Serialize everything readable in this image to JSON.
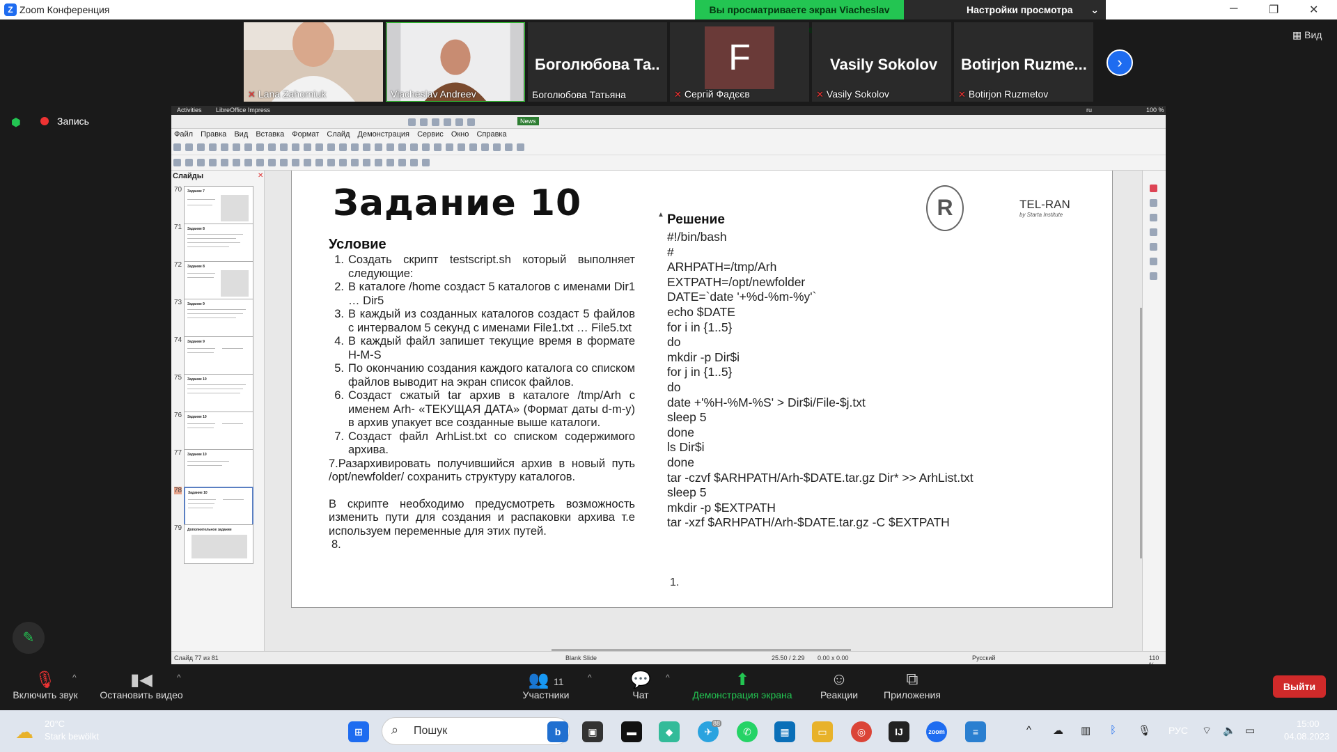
{
  "window": {
    "title": "Zoom Конференция"
  },
  "share_banner": "Вы просматриваете экран Viacheslav Andreev",
  "view_settings": "Настройки просмотра",
  "view_label": "Вид",
  "participants_strip": [
    {
      "name": "Lana Zahorniuk",
      "type": "video",
      "muted": true
    },
    {
      "name": "Viacheslav Andreev",
      "type": "video",
      "muted": false
    },
    {
      "big": "Боголюбова  Та...",
      "name": "Боголюбова Татьяна",
      "muted": false
    },
    {
      "big": "F",
      "name": "Сергій Фадєєв",
      "muted": true
    },
    {
      "big": "Vasily Sokolov",
      "name": "Vasily Sokolov",
      "muted": true
    },
    {
      "big": "Botirjon  Ruzme...",
      "name": "Botirjon Ruzmetov",
      "muted": true
    }
  ],
  "recording_label": "Запись",
  "gnome": {
    "activities": "Activities",
    "app": "LibreOffice Impress",
    "news": "News",
    "lang": "ru",
    "battery": "100 %"
  },
  "lo_menu": [
    "Файл",
    "Правка",
    "Вид",
    "Вставка",
    "Формат",
    "Слайд",
    "Демонстрация",
    "Сервис",
    "Окно",
    "Справка"
  ],
  "slides_panel": {
    "title": "Слайды",
    "thumbs": [
      {
        "num": "70",
        "title": "Задание 7"
      },
      {
        "num": "71",
        "title": "Задание 8"
      },
      {
        "num": "72",
        "title": "Задание 8"
      },
      {
        "num": "73",
        "title": "Задание 9"
      },
      {
        "num": "74",
        "title": "Задание 9"
      },
      {
        "num": "75",
        "title": "Задание 10"
      },
      {
        "num": "76",
        "title": "Задание 10"
      },
      {
        "num": "77",
        "title": "Задание 10"
      },
      {
        "num": "78",
        "title": "Задание 10"
      },
      {
        "num": "79",
        "title": "Дополнительное задание"
      }
    ]
  },
  "slide": {
    "title": "Задание 10",
    "condition_title": "Условие",
    "condition_items": [
      {
        "n": "1.",
        "text": "Создать скрипт testscript.sh который выполняет следующие:"
      },
      {
        "n": "2.",
        "text": "В каталоге /home создаст 5 каталогов с именами Dir1 … Dir5"
      },
      {
        "n": "3.",
        "text": "В каждый из созданных каталогов создаст 5 файлов с интервалом 5 секунд с именами File1.txt … File5.txt"
      },
      {
        "n": "4.",
        "text": "В каждый файл запишет текущие время в формате H-M-S"
      },
      {
        "n": "5.",
        "text": "По окончанию создания каждого каталога со списком файлов выводит на экран список файлов."
      },
      {
        "n": "6.",
        "text": "Создаст сжатый tar архив в каталоге /tmp/Arh с именем Arh- «ТЕКУЩАЯ ДАТА» (Формат даты d-m-y) в архив упакует все созданные выше каталоги."
      },
      {
        "n": "7.",
        "text": "Создаст файл ArhList.txt со списком содержимого архива."
      }
    ],
    "condition_extra": " 7.Разархивировать получившийся архив в новый путь /opt/newfolder/ сохранить структуру каталогов.",
    "condition_note": "В скрипте необходимо предусмотреть возможность изменить пути для создания и распаковки архива т.е используем переменные для этих путей.",
    "condition_last": "8.",
    "solution_title": "Решение",
    "solution_code": "#!/bin/bash\n#\nARHPATH=/tmp/Arh\nEXTPATH=/opt/newfolder\nDATE=`date '+%d-%m-%y'`\necho $DATE\nfor i in {1..5}\ndo\nmkdir -p Dir$i\nfor j in {1..5}\ndo\ndate +'%H-%M-%S' > Dir$i/File-$j.txt\nsleep 5\ndone\nls Dir$i\ndone\ntar -czvf $ARHPATH/Arh-$DATE.tar.gz Dir* >> ArhList.txt\nsleep 5\nmkdir -p $EXTPATH\ntar -xzf $ARHPATH/Arh-$DATE.tar.gz -C $EXTPATH",
    "solution_num": "1.",
    "brand": "TEL-RAN",
    "brand_sub": "by Starta Institute"
  },
  "lo_status": {
    "slide": "Слайд 77 из 81",
    "layout": "Blank Slide",
    "pos": "25.50 / 2.29",
    "size": "0.00 x 0.00",
    "lang": "Русский",
    "zoom": "110 %"
  },
  "controls": {
    "mute": "Включить звук",
    "video": "Остановить видео",
    "participants": "Участники",
    "participants_count": "11",
    "chat": "Чат",
    "share": "Демонстрация экрана",
    "reactions": "Реакции",
    "apps": "Приложения",
    "leave": "Выйти"
  },
  "taskbar": {
    "temp": "20°C",
    "weather": "Stark bewölkt",
    "search": "Пошук",
    "lang": "РУС",
    "time": "15:00",
    "date": "04.08.2023",
    "telegram_badge": "88"
  },
  "colors": {
    "accent_green": "#23c552",
    "zoom_blue": "#1e6cf0",
    "leave_red": "#d02a2a"
  }
}
